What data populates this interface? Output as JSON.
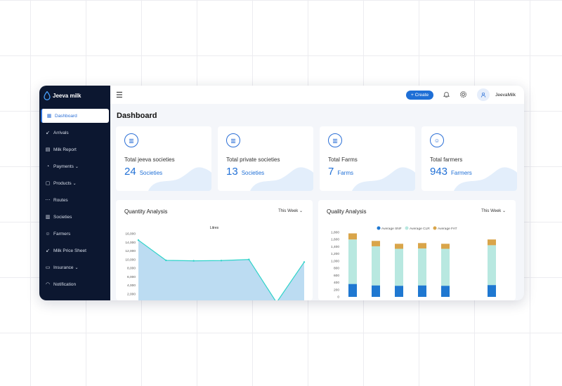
{
  "app": {
    "brand": "Jeeva milk"
  },
  "sidebar": {
    "items": [
      {
        "label": "Dashboard",
        "icon": "grid-icon",
        "active": true,
        "has_chevron": false
      },
      {
        "label": "Arrivals",
        "icon": "arrow-down-left-icon",
        "active": false,
        "has_chevron": false
      },
      {
        "label": "Milk Report",
        "icon": "report-icon",
        "active": false,
        "has_chevron": false
      },
      {
        "label": "Payments",
        "icon": "payments-icon",
        "active": false,
        "has_chevron": true
      },
      {
        "label": "Products",
        "icon": "products-icon",
        "active": false,
        "has_chevron": true
      },
      {
        "label": "Routes",
        "icon": "routes-icon",
        "active": false,
        "has_chevron": false
      },
      {
        "label": "Societies",
        "icon": "societies-icon",
        "active": false,
        "has_chevron": false
      },
      {
        "label": "Farmers",
        "icon": "farmers-icon",
        "active": false,
        "has_chevron": false
      },
      {
        "label": "Milk Price Sheet",
        "icon": "price-sheet-icon",
        "active": false,
        "has_chevron": false
      },
      {
        "label": "Insurance",
        "icon": "insurance-icon",
        "active": false,
        "has_chevron": true
      },
      {
        "label": "Notification",
        "icon": "bell-icon",
        "active": false,
        "has_chevron": false
      }
    ]
  },
  "header": {
    "create_label": "+ Create",
    "username": "JeevaMilk"
  },
  "page": {
    "title": "Dashboard"
  },
  "cards": [
    {
      "label": "Total jeeva societies",
      "value": "24",
      "unit": "Societies"
    },
    {
      "label": "Total private societies",
      "value": "13",
      "unit": "Societies"
    },
    {
      "label": "Total Farms",
      "value": "7",
      "unit": "Farms"
    },
    {
      "label": "Total farmers",
      "value": "943",
      "unit": "Farmers"
    }
  ],
  "colors": {
    "accent": "#1f6fd6",
    "sidebar_bg": "#0c1730",
    "line_stroke": "#2fd3c9",
    "area_fill": "#bcdcf2",
    "snf": "#1f78d1",
    "clr": "#b8e8e0",
    "fat": "#d9a54a"
  },
  "quantity": {
    "title": "Quantity Analysis",
    "filter": "This Week",
    "chart_data": {
      "type": "area",
      "title": "Litres",
      "y_ticks": [
        "16,000",
        "14,000",
        "12,000",
        "10,000",
        "8,000",
        "6,000",
        "4,000",
        "2,000"
      ],
      "ylim": [
        0,
        16000
      ],
      "values": [
        14500,
        9800,
        9700,
        9750,
        10000,
        0,
        9400
      ]
    }
  },
  "quality": {
    "title": "Quality Analysis",
    "filter": "This Week",
    "chart_data": {
      "type": "bar",
      "legend": [
        "Average SNF",
        "Average CLR",
        "Average FAT"
      ],
      "y_ticks": [
        "1,800",
        "1,600",
        "1,400",
        "1,200",
        "1,000",
        "800",
        "600",
        "400",
        "200",
        "0"
      ],
      "ylim": [
        0,
        1800
      ],
      "series": [
        {
          "name": "Average SNF",
          "values": [
            360,
            320,
            310,
            320,
            310,
            null,
            330
          ]
        },
        {
          "name": "Average CLR",
          "values": [
            1240,
            1090,
            1030,
            1030,
            1030,
            null,
            1110
          ]
        },
        {
          "name": "Average FAT",
          "values": [
            170,
            150,
            140,
            150,
            140,
            null,
            160
          ]
        }
      ]
    }
  }
}
